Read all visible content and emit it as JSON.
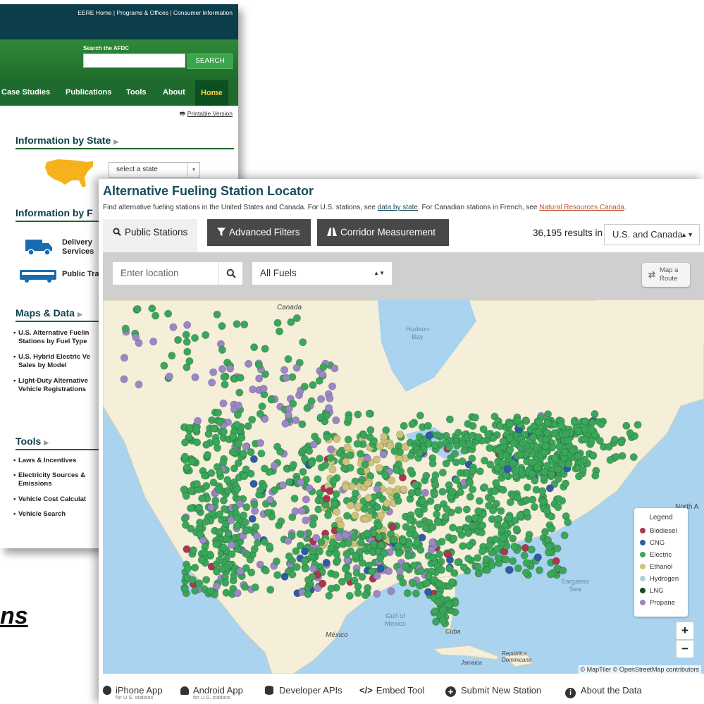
{
  "back_window": {
    "top_links": "EERE Home | Programs & Offices | Consumer Information",
    "search_label": "Search the AFDC",
    "search_button": "SEARCH",
    "nav": [
      "Case Studies",
      "Publications",
      "Tools",
      "About",
      "Home"
    ],
    "printable": "Printable Version",
    "sections": {
      "info_state": "Information by State",
      "info_fuel": "Information by F",
      "maps_data": "Maps & Data",
      "tools": "Tools"
    },
    "state_select": "select a state",
    "icon_items": [
      {
        "label1": "Delivery",
        "label2": "Services"
      },
      {
        "label1": "Public Tra",
        "label2": ""
      }
    ],
    "maps_items": [
      {
        "l1": "U.S. Alternative Fuelin",
        "l2": "Stations by Fuel Type"
      },
      {
        "l1": "U.S. Hybrid Electric Ve",
        "l2": "Sales by Model"
      },
      {
        "l1": "Light-Duty Alternative",
        "l2": "Vehicle Registrations"
      }
    ],
    "tools_items": [
      "Laws & Incentives",
      "Electricity Sources &",
      "Emissions",
      "Vehicle Cost Calculat",
      "Vehicle Search"
    ]
  },
  "bottom_text": "ns",
  "locator": {
    "title": "Alternative Fueling Station Locator",
    "subtitle_a": "Find alternative fueling stations in the United States and Canada. For U.S. stations, see ",
    "subtitle_link1": "data by state",
    "subtitle_b": ". For Canadian stations in French, see ",
    "subtitle_link2": "Natural Resources Canada",
    "subtitle_c": ".",
    "tabs": [
      "Public Stations",
      "Advanced Filters",
      "Corridor Measurement"
    ],
    "results": "36,195 results in",
    "region": "U.S. and Canada",
    "location_placeholder": "Enter location",
    "fuel_select": "All Fuels",
    "route_line1": "Map a",
    "route_line2": "Route",
    "legend_title": "Legend",
    "legend": [
      {
        "name": "Biodiesel",
        "color": "#b0334f"
      },
      {
        "name": "CNG",
        "color": "#2f5aa8"
      },
      {
        "name": "Electric",
        "color": "#3aa65a"
      },
      {
        "name": "Ethanol",
        "color": "#cdc37a"
      },
      {
        "name": "Hydrogen",
        "color": "#a9d3de"
      },
      {
        "name": "LNG",
        "color": "#1c4a2c"
      },
      {
        "name": "Propane",
        "color": "#9b86c6"
      }
    ],
    "map_labels": {
      "canada": "Canada",
      "hudson": "Hudson",
      "bay": "Bay",
      "gulf1": "Gulf of",
      "gulf2": "Mexico",
      "sargasso1": "Sargasso",
      "sargasso2": "Sea",
      "mexico": "México",
      "cuba": "Cuba",
      "jamaica": "Jamaica",
      "dr1": "República",
      "dr2": "Dominicana",
      "northa": "North A"
    },
    "attribution": "© MapTiler © OpenStreetMap contributors",
    "zoom_in": "+",
    "zoom_out": "−",
    "footer": [
      {
        "label": "iPhone App",
        "sub": "for U.S. stations"
      },
      {
        "label": "Android App",
        "sub": "for U.S. stations"
      },
      {
        "label": "Developer APIs",
        "sub": ""
      },
      {
        "label": "Embed Tool",
        "sub": ""
      },
      {
        "label": "Submit New Station",
        "sub": ""
      },
      {
        "label": "About the Data",
        "sub": ""
      }
    ]
  }
}
